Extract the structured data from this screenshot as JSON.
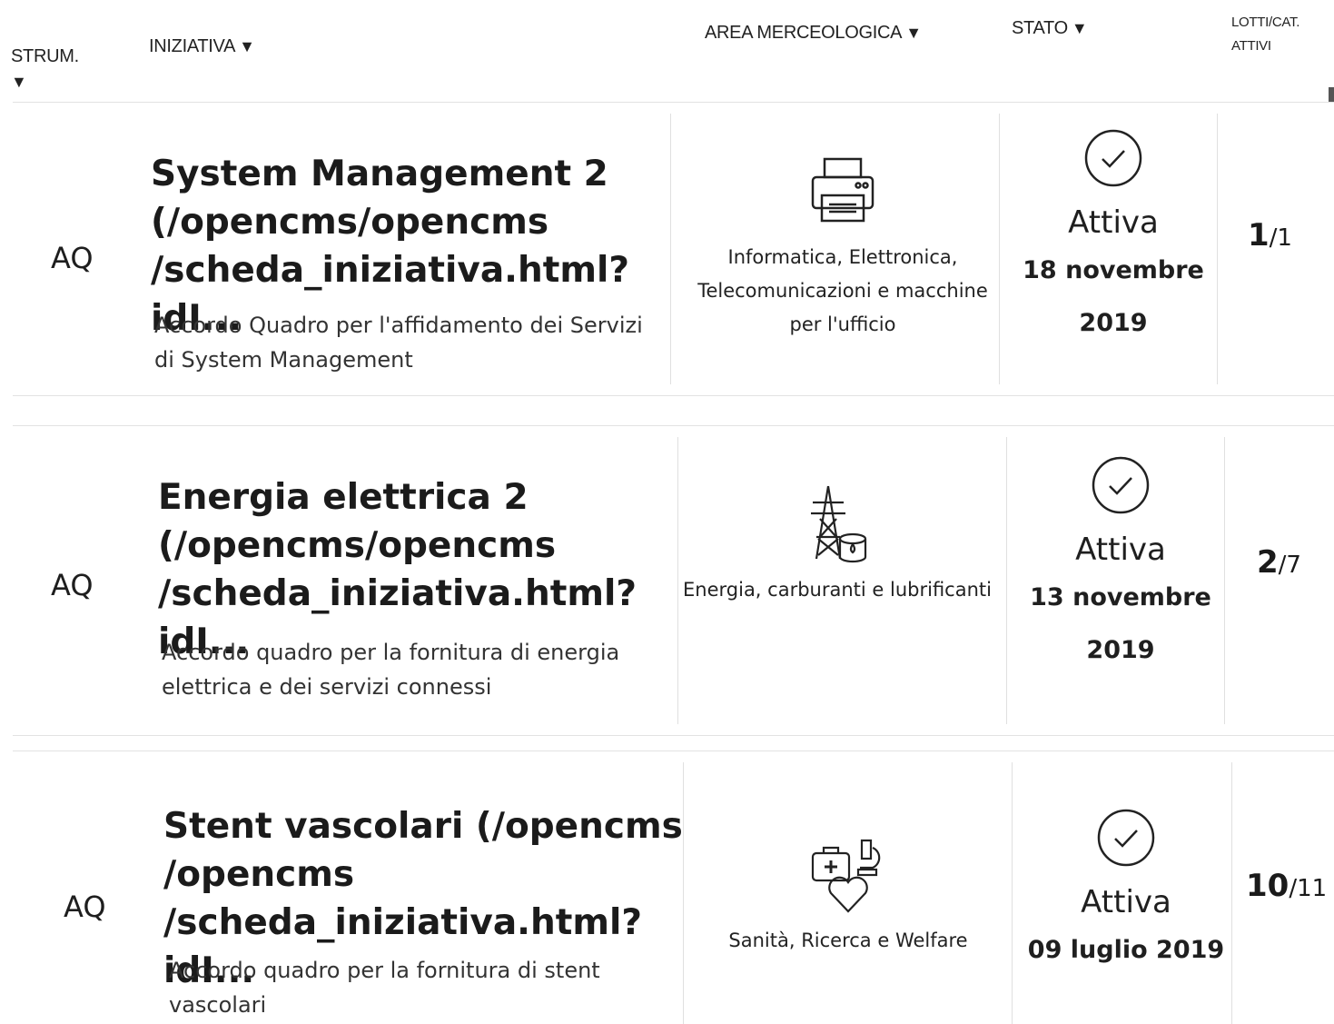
{
  "header": {
    "strum": "STRUM.",
    "iniziativa": "INIZIATIVA",
    "area": "AREA MERCEOLOGICA",
    "stato": "STATO",
    "lotti_line1": "LOTTI/CAT.",
    "lotti_line2": "ATTIVI",
    "sort_arrow": "▼"
  },
  "rows": [
    {
      "strum": "AQ",
      "title": "System Management 2 (/opencms/opencms /scheda_iniziativa.html?idI...",
      "description": "Accordo Quadro per l'affidamento dei Servizi di System Management",
      "area_icon": "printer-icon",
      "area": "Informatica, Elettronica, Telecomunicazioni e macchine per l'ufficio",
      "status": "Attiva",
      "date": "18 novembre 2019",
      "lotti_active": "1",
      "lotti_total": "/1"
    },
    {
      "strum": "AQ",
      "title": "Energia elettrica 2 (/opencms/opencms /scheda_iniziativa.html?idI...",
      "description": "Accordo quadro per la fornitura di energia elettrica e dei servizi connessi",
      "area_icon": "power-pylon-icon",
      "area": "Energia, carburanti e lubrificanti",
      "status": "Attiva",
      "date": "13 novembre 2019",
      "lotti_active": "2",
      "lotti_total": "/7"
    },
    {
      "strum": "AQ",
      "title": "Stent vascolari (/opencms /opencms /scheda_iniziativa.html?idI...",
      "description": "Accordo quadro per la fornitura di stent vascolari",
      "area_icon": "healthcare-icon",
      "area": "Sanità, Ricerca e Welfare",
      "status": "Attiva",
      "date": "09 luglio 2019",
      "lotti_active": "10",
      "lotti_total": "/11"
    }
  ],
  "colors": {
    "text": "#1a1a1a",
    "divider": "#e0e0e0",
    "background": "#ffffff"
  }
}
